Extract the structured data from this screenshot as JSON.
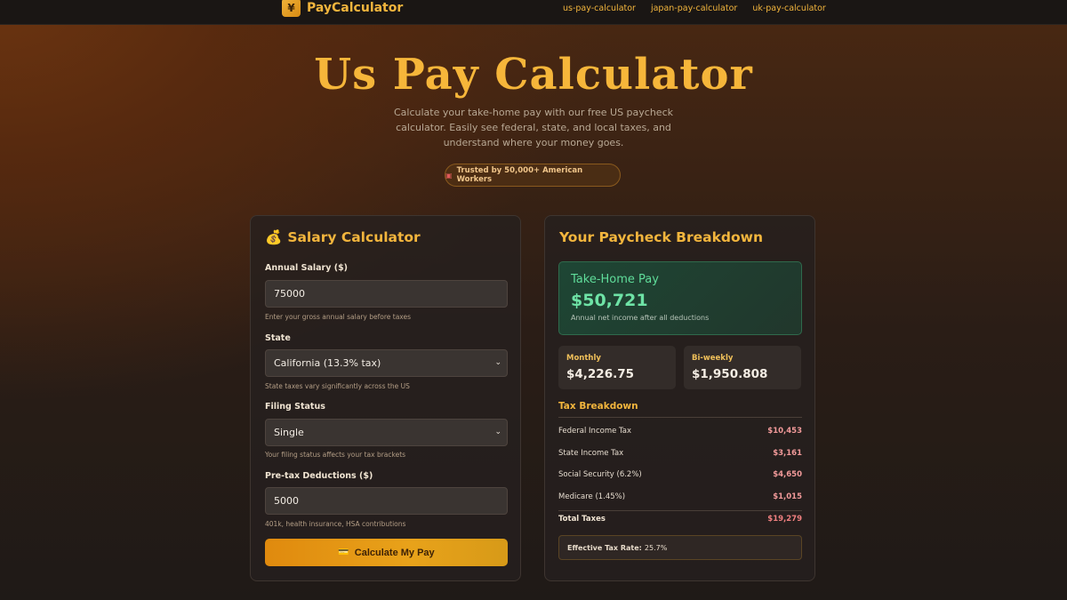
{
  "nav": {
    "brand_icon": "¥",
    "brand": "PayCalculator",
    "links": [
      "us-pay-calculator",
      "japan-pay-calculator",
      "uk-pay-calculator"
    ]
  },
  "hero": {
    "title": "Us Pay Calculator",
    "subtitle": "Calculate your take-home pay with our free US paycheck calculator. Easily see federal, state, and local taxes, and understand where your money goes.",
    "trust_badge": "Trusted by 50,000+ American Workers"
  },
  "calculator": {
    "title": "Salary Calculator",
    "title_icon": "💰",
    "annual_salary": {
      "label": "Annual Salary ($)",
      "value": "75000",
      "hint": "Enter your gross annual salary before taxes"
    },
    "state": {
      "label": "State",
      "value": "California (13.3% tax)",
      "hint": "State taxes vary significantly across the US"
    },
    "filing_status": {
      "label": "Filing Status",
      "value": "Single",
      "hint": "Your filing status affects your tax brackets"
    },
    "pretax": {
      "label": "Pre-tax Deductions ($)",
      "value": "5000",
      "hint": "401k, health insurance, HSA contributions"
    },
    "button": "Calculate My Pay",
    "button_icon": "💳"
  },
  "breakdown": {
    "title": "Your Paycheck Breakdown",
    "takehome": {
      "label": "Take-Home Pay",
      "value": "$50,721",
      "note": "Annual net income after all deductions"
    },
    "monthly": {
      "label": "Monthly",
      "value": "$4,226.75"
    },
    "biweekly": {
      "label": "Bi-weekly",
      "value": "$1,950.808"
    },
    "tax_title": "Tax Breakdown",
    "rows": [
      {
        "label": "Federal Income Tax",
        "value": "$10,453"
      },
      {
        "label": "State Income Tax",
        "value": "$3,161"
      },
      {
        "label": "Social Security (6.2%)",
        "value": "$4,650"
      },
      {
        "label": "Medicare (1.45%)",
        "value": "$1,015"
      }
    ],
    "total": {
      "label": "Total Taxes",
      "value": "$19,279"
    },
    "effective_label": "Effective Tax Rate:",
    "effective_value": "25.7%"
  },
  "colors": {
    "accent": "#f2b53d",
    "positive": "#6ee3a6",
    "tax": "#f29a9a"
  }
}
